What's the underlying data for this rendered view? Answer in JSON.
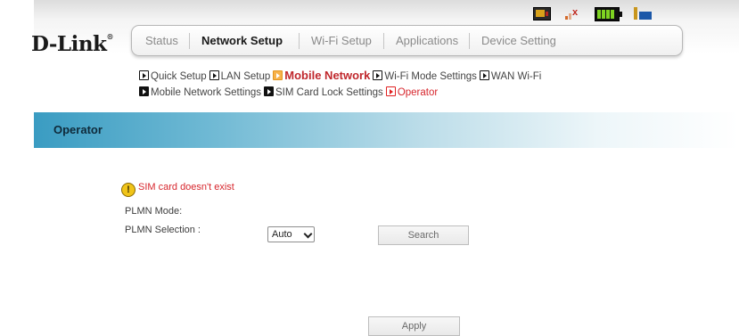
{
  "brand": {
    "logo_text": "D-Link",
    "logo_mark": "®"
  },
  "status_icons": [
    "sms-icon",
    "signal-x-icon",
    "battery-icon",
    "network-icon"
  ],
  "nav": {
    "tabs": [
      {
        "label": "Status",
        "active": false
      },
      {
        "label": "Network Setup",
        "active": true
      },
      {
        "label": "Wi-Fi Setup",
        "active": false
      },
      {
        "label": "Applications",
        "active": false
      },
      {
        "label": "Device Setting",
        "active": false
      }
    ]
  },
  "subnav": {
    "row1": [
      "Quick Setup",
      "LAN Setup",
      "Mobile Network",
      "Wi-Fi Mode Settings",
      "WAN Wi-Fi"
    ],
    "row2": [
      "Mobile Network Settings",
      "SIM Card Lock Settings",
      "Operator"
    ]
  },
  "section": {
    "title": "Operator"
  },
  "warning": {
    "icon": "warning-icon",
    "text": "SIM card doesn't exist"
  },
  "form": {
    "plmn_mode_label": "PLMN Mode:",
    "plmn_selection_label": "PLMN Selection :",
    "plmn_selection_value": "Auto",
    "search_label": "Search",
    "apply_label": "Apply"
  },
  "colors": {
    "accent": "#3a9cc2",
    "active_subnav": "#c0282d",
    "warning_text": "#d7262d"
  }
}
